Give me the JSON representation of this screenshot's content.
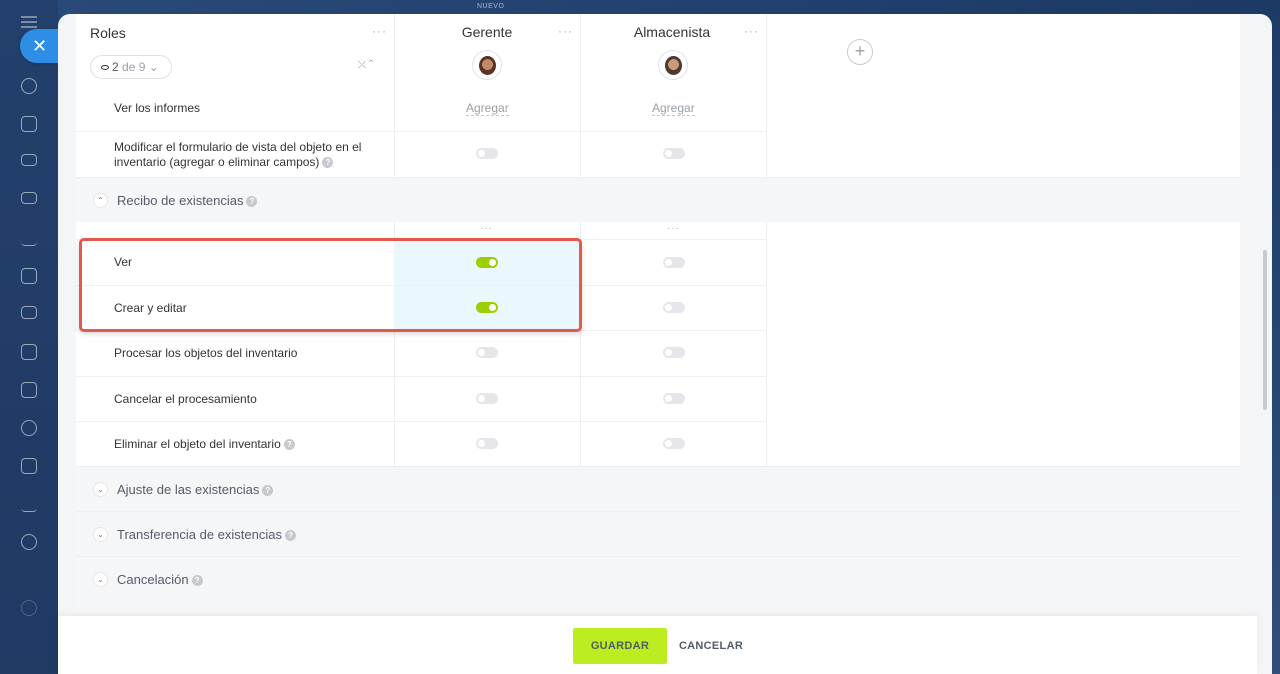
{
  "top": {
    "badge": "NUEVO"
  },
  "header": {
    "roles_title": "Roles",
    "more_glyph": "···",
    "filter": {
      "count": "2",
      "of_text": "de 9"
    },
    "roles": [
      {
        "name": "Gerente"
      },
      {
        "name": "Almacenista"
      }
    ],
    "add_role": "+"
  },
  "rows_top": [
    {
      "label": "Ver los informes",
      "values": [
        "Agregar",
        "Agregar"
      ]
    },
    {
      "label": "Modificar el formulario de vista del objeto en el inventario (agregar o eliminar campos)",
      "values": [
        false,
        false
      ]
    }
  ],
  "sections": [
    {
      "title": "Recibo de existencias",
      "expanded": true,
      "rows": [
        {
          "label": "Ver",
          "values": [
            true,
            false
          ],
          "highlighted": true
        },
        {
          "label": "Crear y editar",
          "values": [
            true,
            false
          ],
          "highlighted": true
        },
        {
          "label": "Procesar los objetos del inventario",
          "values": [
            false,
            false
          ]
        },
        {
          "label": "Cancelar el procesamiento",
          "values": [
            false,
            false
          ]
        },
        {
          "label": "Eliminar el objeto del inventario",
          "values": [
            false,
            false
          ],
          "help": true
        }
      ]
    },
    {
      "title": "Ajuste de las existencias",
      "expanded": false
    },
    {
      "title": "Transferencia de existencias",
      "expanded": false
    },
    {
      "title": "Cancelación",
      "expanded": false
    }
  ],
  "footer": {
    "save_label": "GUARDAR",
    "cancel_label": "CANCELAR"
  },
  "colors": {
    "toggle_on": "#9dcf00",
    "save_button": "#bbed21",
    "highlight_border": "#e2594d",
    "highlight_fill": "#eaf7fc"
  }
}
